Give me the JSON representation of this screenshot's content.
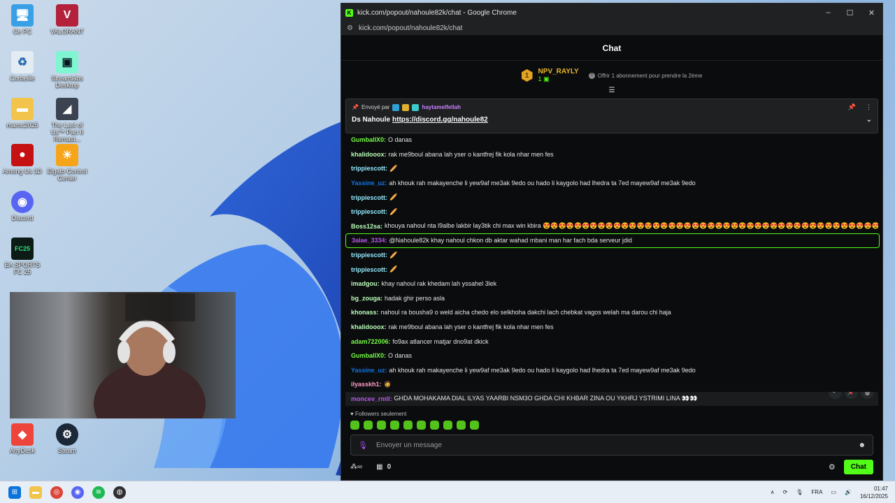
{
  "desktop": {
    "icons": [
      {
        "label": "Ce PC"
      },
      {
        "label": "VALORANT"
      },
      {
        "label": "Corbeille"
      },
      {
        "label": "Streamlabs Desktop"
      },
      {
        "label": "maroc2025"
      },
      {
        "label": "The Last of Us™ Part II Remast..."
      },
      {
        "label": "Among Us 3D"
      },
      {
        "label": "Elgato Control Center"
      },
      {
        "label": "Discord"
      },
      {
        "label": "EA SPORTS FC 25"
      },
      {
        "label": "AnyDesk"
      },
      {
        "label": "Steam"
      }
    ]
  },
  "window": {
    "title": "kick.com/popout/nahoule82k/chat - Google Chrome",
    "url": "kick.com/popout/nahoule82k/chat",
    "min": "–",
    "max": "☐",
    "close": "✕"
  },
  "chat": {
    "header": "Chat",
    "top_supporter": {
      "rank": "1",
      "name": "NPV_RAYLY",
      "count": "1",
      "offer": "Offrir 1 abonnement pour prendre la 2ème"
    },
    "pinned": {
      "sent_by": "Envoyé par",
      "user": "haytamelfellah",
      "text": "Ds Nahoule",
      "link": "https://discord.gg/nahoule82"
    },
    "messages": [
      {
        "user": "GumballX0:",
        "color": "#75fd46",
        "text": "O danas"
      },
      {
        "user": "khalidooox:",
        "color": "#bcffbd",
        "text": "rak me9boul abana lah yser o kantfrej fik kola nhar men fes"
      },
      {
        "user": "trippiescott:",
        "color": "#93ebff",
        "text": "🥖"
      },
      {
        "user": "Yassine_uz:",
        "color": "#1475e1",
        "text": "ah khouk rah makayenche li yew9af me3ak 9edo ou hado li kaygolo had lhedra ta 7ed mayew9af me3ak 9edo"
      },
      {
        "user": "trippiescott:",
        "color": "#93ebff",
        "text": "🥖"
      },
      {
        "user": "trippiescott:",
        "color": "#93ebff",
        "text": "🥖"
      },
      {
        "user": "Boss12sa:",
        "color": "#bcffbd",
        "text": "khouya nahoul nta l9albe lakbir lay3tik chi max win kbira 😍😍😍😍😍😍😍😍😍😍😍😍😍😍😍😍😍😍😍😍😍😍😍😍😍😍😍😍😍😍😍😍😍😍😍😍😍😍😍😍😍😍😍😍😍😍😍😍😍😍😍😍😍😍😍😍😍😍😍😍"
      },
      {
        "user": "3alae_3334:",
        "color": "#b45ae6",
        "text": "@Nahoule82k khay nahoul chkon db aktar wahad mbani man har fach bda serveur jdid"
      },
      {
        "user": "trippiescott:",
        "color": "#93ebff",
        "text": "🥖"
      },
      {
        "user": "trippiescott:",
        "color": "#93ebff",
        "text": "🥖"
      },
      {
        "user": "imadgou:",
        "color": "#bcffbd",
        "text": "khay nahoul rak khedam lah yssahel 3lek"
      },
      {
        "user": "bg_zouga:",
        "color": "#bcffbd",
        "text": "hadak ghir perso asla"
      },
      {
        "user": "khonass:",
        "color": "#bcffbd",
        "text": "nahoul ra bousha9 o weld aicha chedo elo selkhoha dakchi lach chebkat vagos welah ma darou chi haja"
      },
      {
        "user": "khalidooox:",
        "color": "#bcffbd",
        "text": "rak me9boul abana lah yser o kantfrej fik kola nhar men fes"
      },
      {
        "user": "adam722006:",
        "color": "#75fd46",
        "text": "fo9ax atlancer matjar dno9at dkick"
      },
      {
        "user": "GumballX0:",
        "color": "#75fd46",
        "text": "O danas"
      },
      {
        "user": "Yassine_uz:",
        "color": "#1475e1",
        "text": "ah khouk rah makayenche li yew9af me3ak 9edo ou hado li kaygolo had lhedra ta 7ed mayew9af me3ak 9edo"
      },
      {
        "user": "ilyasskh1:",
        "color": "#ff9ecb",
        "text": "🧔"
      },
      {
        "user": "moncev_rmll:",
        "color": "#b45ae6",
        "text": "GHDA MOHAKAMA DIAL ILYAS YAARBI NSM3O GHDA CHI KHBAR ZINA OU YKHRJ YSTRIMI LINA 👀👀"
      }
    ],
    "followers_only": "Followers seulement",
    "input_placeholder": "Envoyer un message",
    "points_value": "0",
    "chat_button": "Chat"
  },
  "taskbar": {
    "lang": "FRA",
    "time": "01:47",
    "date": "16/12/2025"
  }
}
